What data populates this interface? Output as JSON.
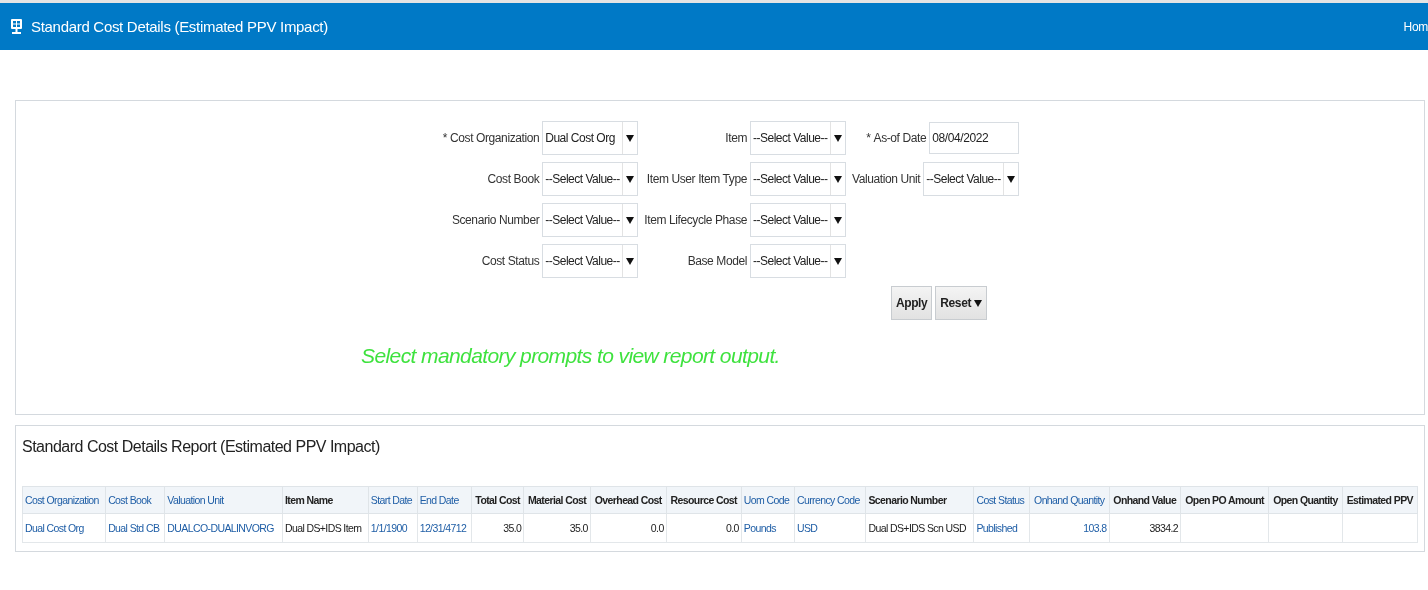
{
  "header": {
    "title": "Standard Cost Details (Estimated PPV Impact)",
    "link": "Hom"
  },
  "prompts": {
    "columns": [
      [
        {
          "label": "Cost Organization",
          "required": true,
          "kind": "select",
          "value": "Dual Cost Org"
        },
        {
          "label": "Cost Book",
          "required": false,
          "kind": "select",
          "value": "--Select Value--"
        },
        {
          "label": "Scenario Number",
          "required": false,
          "kind": "select",
          "value": "--Select Value--"
        },
        {
          "label": "Cost Status",
          "required": false,
          "kind": "select",
          "value": "--Select Value--"
        }
      ],
      [
        {
          "label": "Item",
          "required": false,
          "kind": "select",
          "value": "--Select Value--"
        },
        {
          "label": "Item User Item Type",
          "required": false,
          "kind": "select",
          "value": "--Select Value--"
        },
        {
          "label": "Item Lifecycle Phase",
          "required": false,
          "kind": "select",
          "value": "--Select Value--"
        },
        {
          "label": "Base Model",
          "required": false,
          "kind": "select",
          "value": "--Select Value--"
        }
      ],
      [
        {
          "label": "As-of Date",
          "required": true,
          "kind": "date",
          "value": "08/04/2022"
        },
        {
          "label": "Valuation Unit",
          "required": false,
          "kind": "select",
          "value": "--Select Value--"
        }
      ]
    ],
    "required_mark": "*",
    "buttons": [
      {
        "label": "Apply",
        "menu": false
      },
      {
        "label": "Reset",
        "menu": true
      }
    ],
    "message": "Select mandatory prompts to view report output."
  },
  "report": {
    "title": "Standard Cost Details Report (Estimated PPV Impact)",
    "columns": [
      {
        "label": "Cost Organization",
        "link": true,
        "numeric": false
      },
      {
        "label": "Cost Book",
        "link": true,
        "numeric": false
      },
      {
        "label": "Valuation Unit",
        "link": true,
        "numeric": false
      },
      {
        "label": "Item Name",
        "link": false,
        "numeric": false
      },
      {
        "label": "Start Date",
        "link": true,
        "numeric": false
      },
      {
        "label": "End Date",
        "link": true,
        "numeric": false
      },
      {
        "label": "Total Cost",
        "link": false,
        "numeric": true
      },
      {
        "label": "Material Cost",
        "link": false,
        "numeric": true
      },
      {
        "label": "Overhead Cost",
        "link": false,
        "numeric": true
      },
      {
        "label": "Resource Cost",
        "link": false,
        "numeric": true
      },
      {
        "label": "Uom Code",
        "link": true,
        "numeric": false
      },
      {
        "label": "Currency Code",
        "link": true,
        "numeric": false
      },
      {
        "label": "Scenario Number",
        "link": false,
        "numeric": false
      },
      {
        "label": "Cost Status",
        "link": true,
        "numeric": false
      },
      {
        "label": "Onhand Quantity",
        "link": true,
        "numeric": true
      },
      {
        "label": "Onhand Value",
        "link": false,
        "numeric": true
      },
      {
        "label": "Open PO Amount",
        "link": false,
        "numeric": true
      },
      {
        "label": "Open Quantity",
        "link": false,
        "numeric": true
      },
      {
        "label": "Estimated PPV",
        "link": false,
        "numeric": true
      }
    ],
    "rows": [
      [
        "Dual Cost Org",
        "Dual Std CB",
        "DUALCO-DUALINVORG",
        "Dual DS+IDS Item",
        "1/1/1900",
        "12/31/4712",
        "35.0",
        "35.0",
        "0.0",
        "0.0",
        "Pounds",
        "USD",
        "Dual DS+IDS Scn USD",
        "Published",
        "103.8",
        "3834.2",
        "",
        "",
        ""
      ]
    ]
  }
}
